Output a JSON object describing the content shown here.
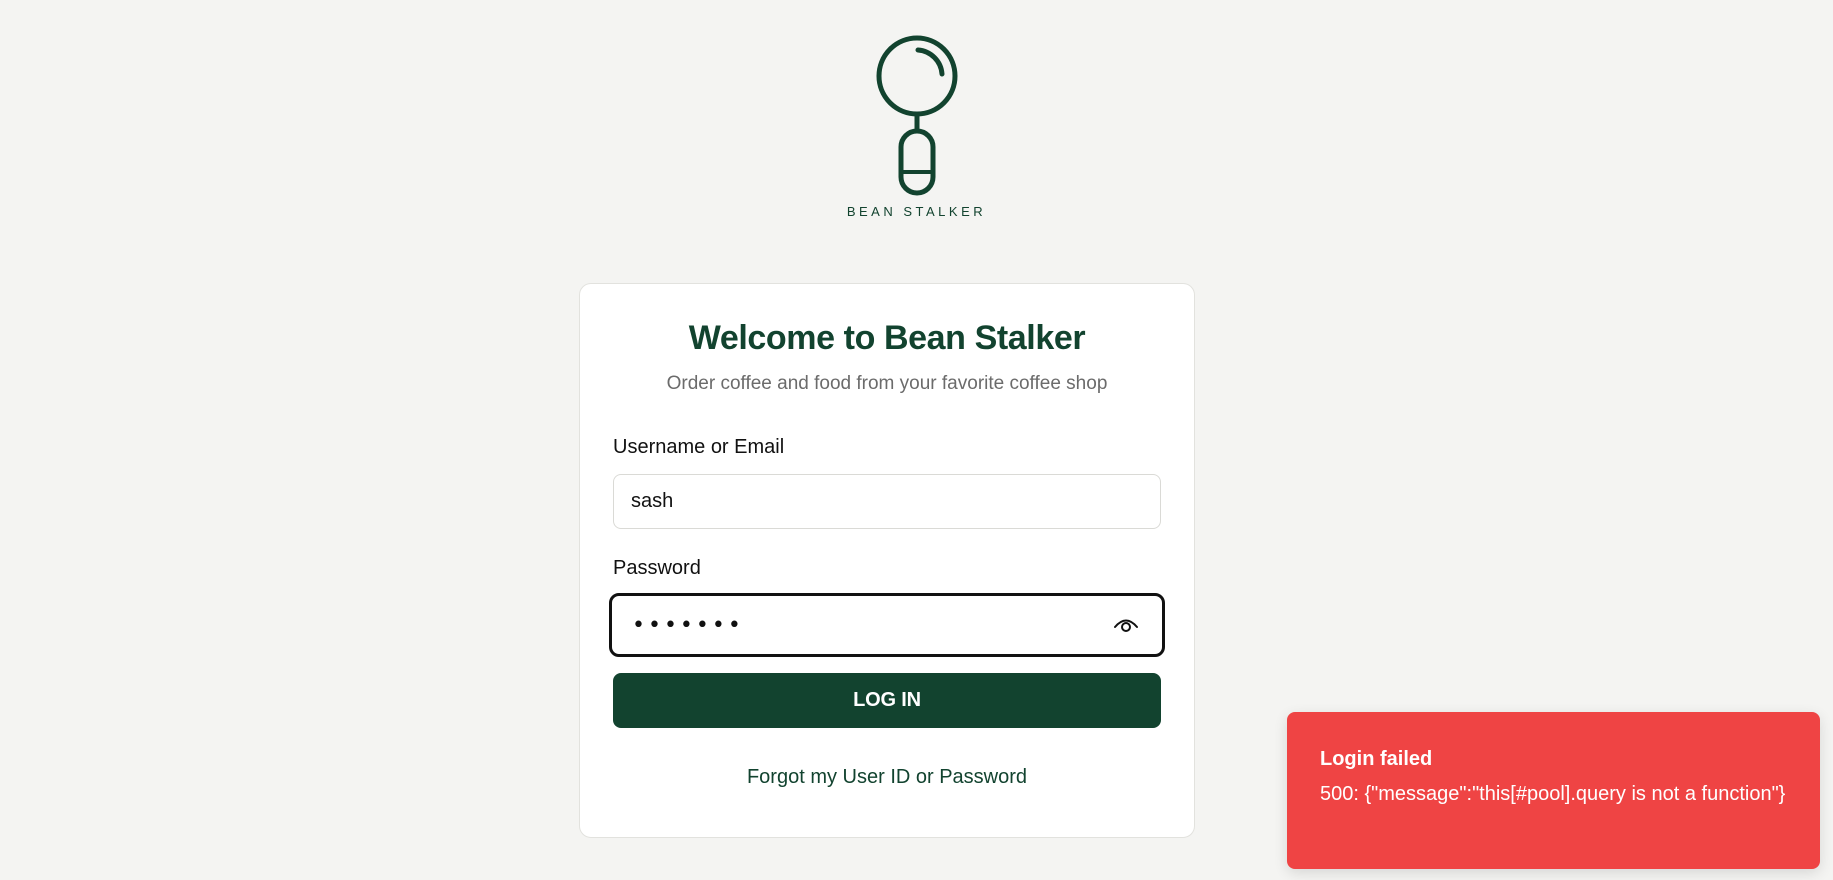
{
  "brand": {
    "name": "BEAN STALKER",
    "primary_color": "#12432f",
    "logo_icon": "coffee-portafilter-icon"
  },
  "login_card": {
    "title": "Welcome to Bean Stalker",
    "subtitle": "Order coffee and food from your favorite coffee shop",
    "username": {
      "label": "Username or Email",
      "value": "sash"
    },
    "password": {
      "label": "Password",
      "masked_value": "•••••••",
      "toggle_icon": "eye-icon"
    },
    "login_button_label": "LOG IN",
    "forgot_link": "Forgot my User ID or Password"
  },
  "toast": {
    "title": "Login failed",
    "message": "500: {\"message\":\"this[#pool].query is not a function\"}",
    "color": "#ef4444"
  }
}
